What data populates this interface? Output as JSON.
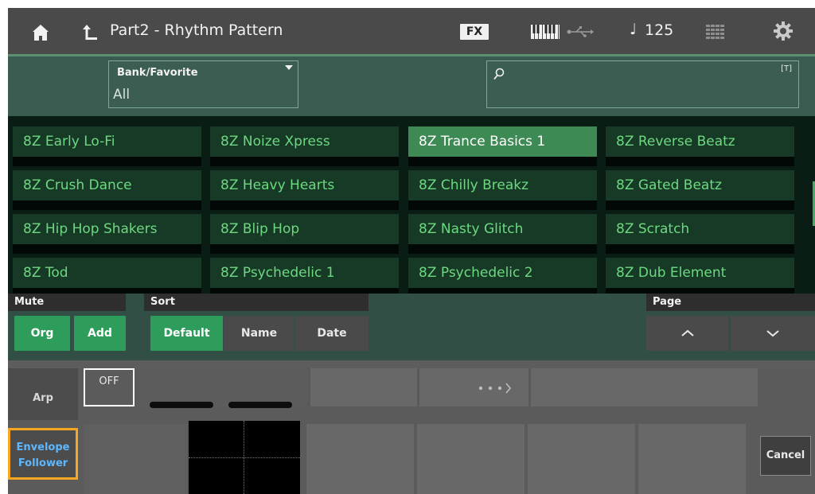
{
  "header": {
    "title": "Part2 - Rhythm Pattern",
    "fx_label": "FX",
    "tempo": "125",
    "note_symbol": "♩",
    "icons": [
      "home-icon",
      "up-icon",
      "keyboard-icon",
      "usb-icon",
      "grid-icon",
      "gear-icon"
    ],
    "accent_color": "#5d8f73"
  },
  "filter": {
    "bank_label": "Bank/Favorite",
    "bank_value": "All",
    "search_value": "",
    "text_input_badge": "[T]"
  },
  "patterns": [
    {
      "label": "8Z Early Lo-Fi",
      "selected": false
    },
    {
      "label": "8Z Noize Xpress",
      "selected": false
    },
    {
      "label": "8Z Trance Basics 1",
      "selected": true
    },
    {
      "label": "8Z Reverse Beatz",
      "selected": false
    },
    {
      "label": "8Z Crush Dance",
      "selected": false
    },
    {
      "label": "8Z Heavy Hearts",
      "selected": false
    },
    {
      "label": "8Z Chilly Breakz",
      "selected": false
    },
    {
      "label": "8Z Gated Beatz",
      "selected": false
    },
    {
      "label": "8Z Hip Hop Shakers",
      "selected": false
    },
    {
      "label": "8Z Blip Hop",
      "selected": false
    },
    {
      "label": "8Z Nasty Glitch",
      "selected": false
    },
    {
      "label": "8Z Scratch",
      "selected": false
    },
    {
      "label": "8Z Tod",
      "selected": false
    },
    {
      "label": "8Z Psychedelic 1",
      "selected": false
    },
    {
      "label": "8Z Psychedelic 2",
      "selected": false
    },
    {
      "label": "8Z Dub Element",
      "selected": false
    }
  ],
  "mute": {
    "header": "Mute",
    "org_label": "Org",
    "add_label": "Add",
    "org_active": true,
    "add_active": true
  },
  "sort": {
    "header": "Sort",
    "options": [
      "Default",
      "Name",
      "Date"
    ],
    "selected": "Default"
  },
  "page": {
    "header": "Page"
  },
  "bottom": {
    "arp_label": "Arp",
    "env_label_1": "Envelope",
    "env_label_2": "Follower",
    "off_label": "OFF",
    "cancel_label": "Cancel",
    "highlight_color": "#f5a623"
  }
}
